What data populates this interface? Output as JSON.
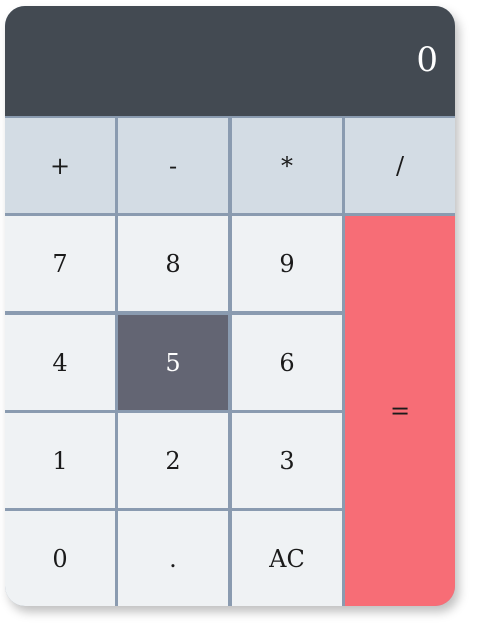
{
  "display": {
    "value": "0"
  },
  "operators": [
    "+",
    "-",
    "*",
    "/"
  ],
  "keys": {
    "seven": "7",
    "eight": "8",
    "nine": "9",
    "four": "4",
    "five": "5",
    "six": "6",
    "one": "1",
    "two": "2",
    "three": "3",
    "zero": "0",
    "decimal": ".",
    "clear": "AC",
    "equals": "="
  },
  "pressed_key": "5",
  "colors": {
    "display_bg": "#434a52",
    "operator_bg": "#d3dce4",
    "number_bg": "#eff2f4",
    "pressed_bg": "#636573",
    "equals_bg": "#f76d76",
    "gap": "#8a9bb0"
  }
}
